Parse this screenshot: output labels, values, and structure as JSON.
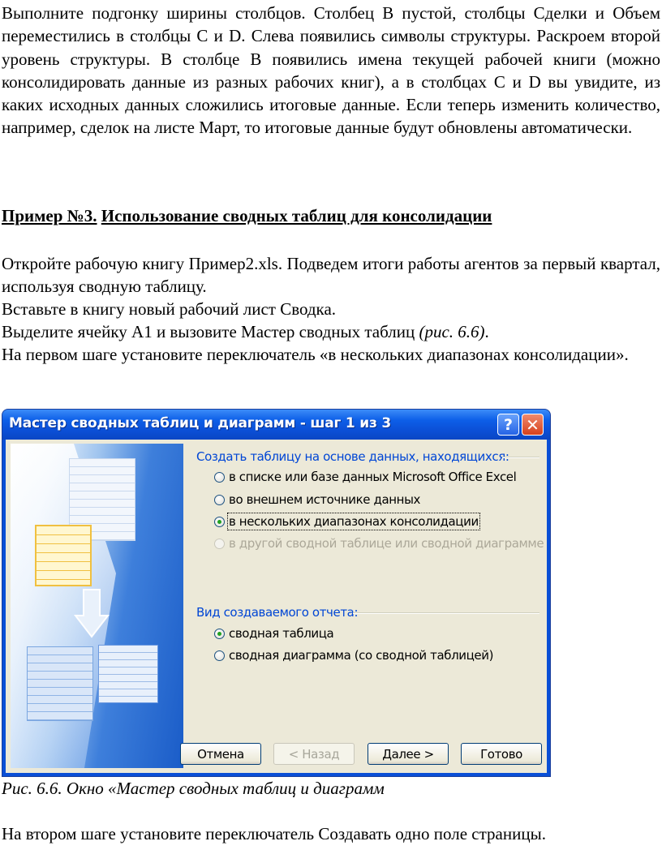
{
  "text": {
    "para1": "Выполните подгонку ширины столбцов. Столбец В пустой, столбцы Сделки и Объем переместились в столбцы С и D. Слева появились символы структуры. Раскроем второй уровень структуры. В столбце В появились имена текущей рабочей книги (можно консолидировать данные из разных рабочих книг), а в столбцах С и D вы увидите, из каких исходных данных сложились итоговые данные. Если теперь изменить количество, например, сделок на листе Март, то итоговые данные будут обновлены автоматически.",
    "heading_num": "Пример №3.",
    "heading_rest": "Использование сводных таблиц для консолидации",
    "para2": "Откройте рабочую книгу Пример2.xls. Подведем итоги работы агентов за первый квартал, используя сводную таблицу.",
    "para3": "Вставьте в книгу новый рабочий лист Сводка.",
    "para4_main": "Выделите ячейку А1 и вызовите Мастер сводных таблиц ",
    "para4_ref": "(рис. 6.6)",
    "para4_end": ".",
    "para5": "На первом шаге установите переключатель «в нескольких диапазонах консолидации».",
    "caption": "Рис. 6.6.  Окно «Мастер сводных таблиц и диаграмм",
    "final": "На втором шаге установите  переключатель Создавать одно поле страницы."
  },
  "dialog": {
    "title": "Мастер сводных таблиц и диаграмм - шаг 1 из 3",
    "help_glyph": "?",
    "close_glyph": "✕",
    "source_group": {
      "label": "Создать таблицу на основе данных, находящихся:",
      "options": [
        {
          "label": "в списке или базе данных Microsoft Office Excel",
          "selected": false,
          "enabled": true
        },
        {
          "label": "во внешнем источнике данных",
          "selected": false,
          "enabled": true
        },
        {
          "label": "в нескольких диапазонах консолидации",
          "selected": true,
          "enabled": true
        },
        {
          "label": "в другой сводной таблице или сводной диаграмме",
          "selected": false,
          "enabled": false
        }
      ]
    },
    "report_group": {
      "label": "Вид создаваемого отчета:",
      "options": [
        {
          "label": "сводная таблица",
          "selected": true,
          "enabled": true
        },
        {
          "label": "сводная диаграмма (со сводной таблицей)",
          "selected": false,
          "enabled": true
        }
      ]
    },
    "buttons": {
      "cancel": "Отмена",
      "back": "< Назад",
      "next": "Далее >",
      "finish": "Готово"
    }
  }
}
